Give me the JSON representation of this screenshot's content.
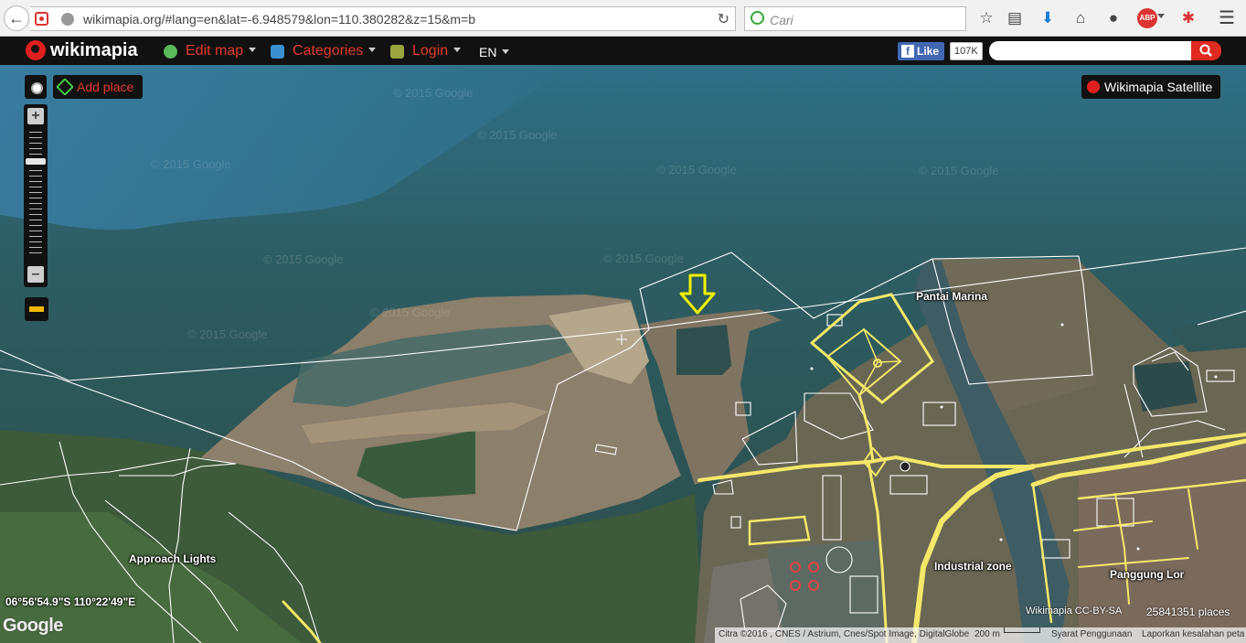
{
  "browser": {
    "url": "wikimapia.org/#lang=en&lat=-6.948579&lon=110.380282&z=15&m=b",
    "search_placeholder": "Cari",
    "icons": [
      "back-icon",
      "reload-icon",
      "bookmark-star-icon",
      "reading-list-icon",
      "download-icon",
      "home-icon",
      "chat-icon",
      "adblock-icon",
      "addon-icon",
      "menu-icon"
    ]
  },
  "header": {
    "logo": "wikimapia",
    "menu": {
      "edit_map": "Edit map",
      "categories": "Categories",
      "login": "Login",
      "language": "EN"
    },
    "facebook": {
      "like_label": "Like",
      "like_count": "107K"
    }
  },
  "map": {
    "add_place": "Add place",
    "layer_button": "Wikimapia Satellite",
    "labels": {
      "pantai_marina": "Pantai Marina",
      "approach_lights": "Approach Lights",
      "industrial_zone": "Industrial zone",
      "panggung_lor": "Panggung Lor"
    },
    "coordinates": "06°56'54.9\"S 110°22'49\"E",
    "google_logo": "Google",
    "license": "Wikimapia CC-BY-SA",
    "places_count": "25841351 places",
    "attribution": {
      "imagery": "Citra ©2016 , CNES / Astrium, Cnes/Spot Image, DigitalGlobe",
      "scale": "200 m",
      "terms": "Syarat Penggunaan",
      "report": "Laporkan kesalahan peta"
    },
    "watermark": "© 2015 Google",
    "colors": {
      "accent": "#e43a2f",
      "road": "#f4e86a",
      "marker": "#f2f200"
    }
  }
}
